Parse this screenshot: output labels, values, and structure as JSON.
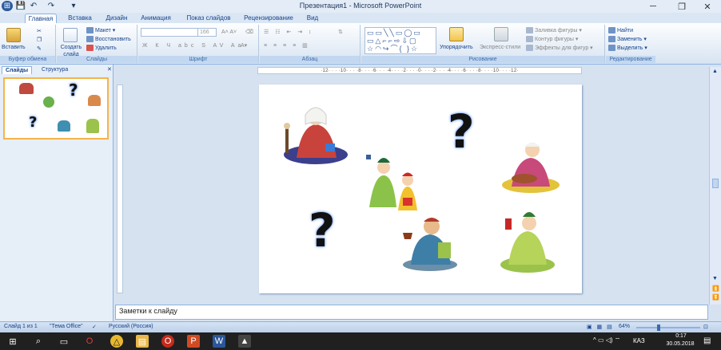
{
  "window": {
    "title": "Презентация1 - Microsoft PowerPoint"
  },
  "quick_access": {
    "office": "⊞",
    "save": "💾",
    "undo": "↶",
    "redo": "↷",
    "customize": "▾"
  },
  "window_controls": {
    "minimize": "─",
    "maximize": "❐",
    "close": "✕"
  },
  "tabs": [
    "Главная",
    "Вставка",
    "Дизайн",
    "Анимация",
    "Показ слайдов",
    "Рецензирование",
    "Вид"
  ],
  "active_tab": "Главная",
  "ribbon": {
    "clipboard": {
      "label": "Буфер обмена",
      "paste": "Вставить"
    },
    "slides": {
      "label": "Слайды",
      "new_slide": "Создать слайд",
      "layout": "Макет",
      "reset": "Восстановить",
      "delete": "Удалить"
    },
    "font": {
      "label": "Шрифт",
      "size": "166"
    },
    "paragraph": {
      "label": "Абзац"
    },
    "drawing": {
      "label": "Рисование",
      "arrange": "Упорядочить",
      "quick_styles": "Экспресс-стили",
      "shape_fill": "Заливка фигуры",
      "shape_outline": "Контур фигуры",
      "shape_effects": "Эффекты для фигур"
    },
    "editing": {
      "label": "Редактирование",
      "find": "Найти",
      "replace": "Заменить",
      "select": "Выделить"
    }
  },
  "panel": {
    "tab_slides": "Слайды",
    "tab_outline": "Структура",
    "slide_number": "1"
  },
  "ruler": {
    "horizontal": "·12· · · ·10· · · ·8· · · ·6· · · ·4· · · ·2· · · ·0· · · ·2· · · ·4· · · ·6· · · ·8· · · ·10· · · ·12·"
  },
  "slide": {
    "question_mark": "?"
  },
  "notes": {
    "placeholder": "Заметки к слайду"
  },
  "status": {
    "slide_info": "Слайд 1 из 1",
    "theme": "\"Тема Office\"",
    "language": "Русский (Россия)",
    "zoom": "64%"
  },
  "taskbar": {
    "lang": "КАЗ",
    "time": "0:17",
    "date": "30.05.2018"
  }
}
